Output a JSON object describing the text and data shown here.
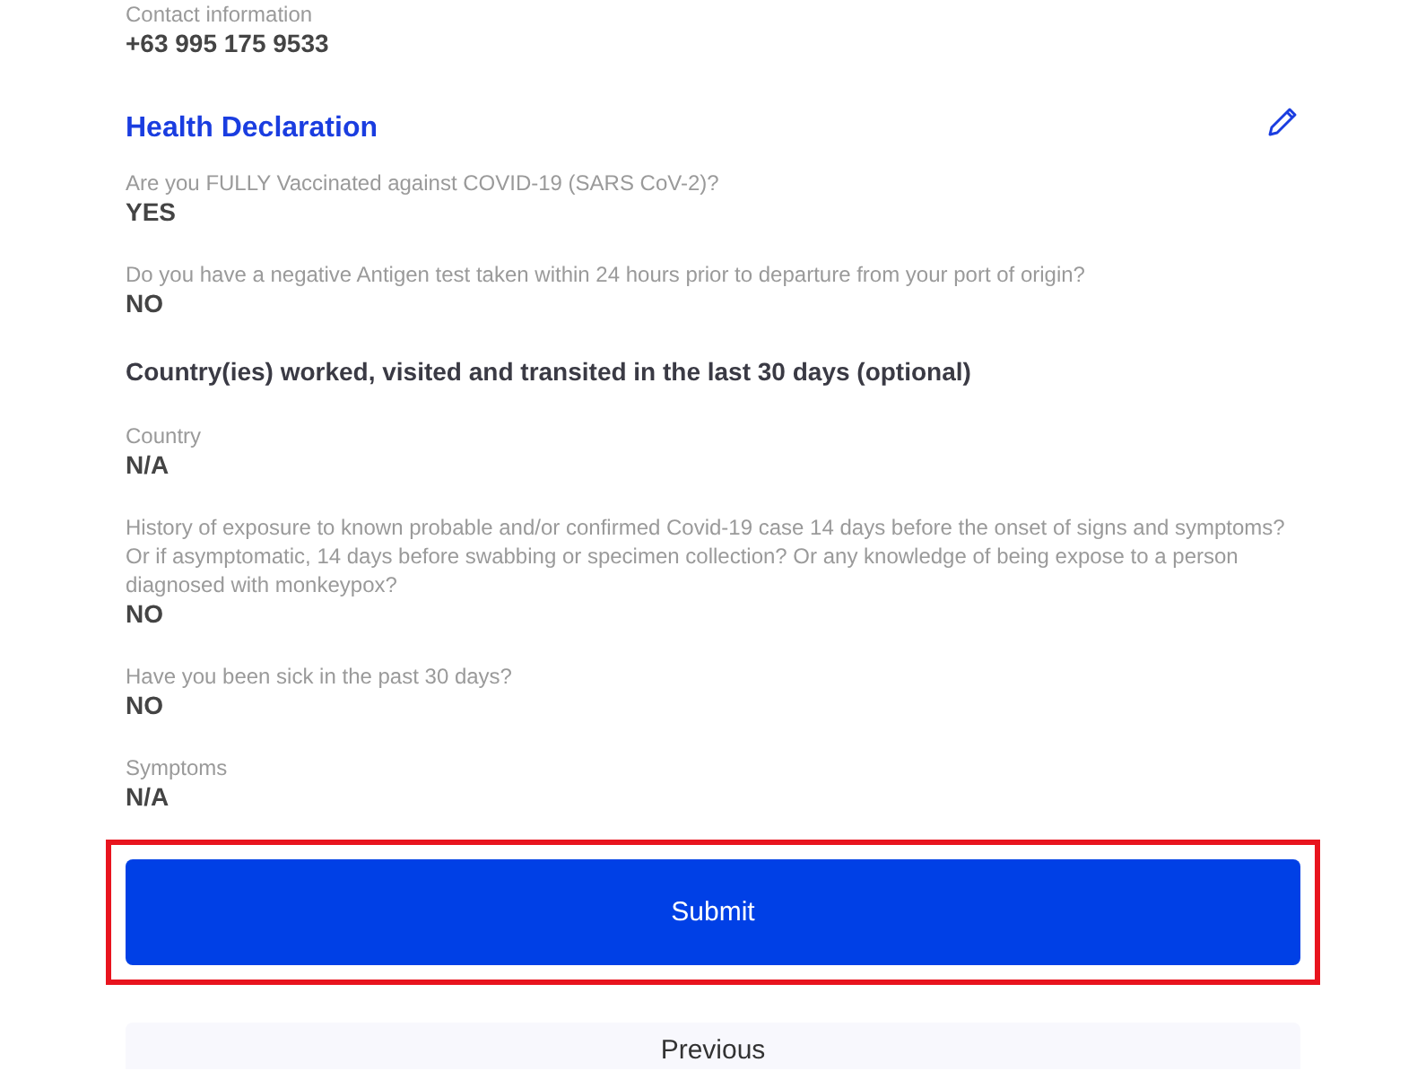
{
  "contact": {
    "label": "Contact information",
    "value": "+63 995 175 9533"
  },
  "health_declaration": {
    "title": "Health Declaration",
    "items": [
      {
        "kind": "field",
        "label": "Are you FULLY Vaccinated against COVID-19 (SARS CoV-2)?",
        "value": "YES"
      },
      {
        "kind": "field",
        "label": "Do you have a negative Antigen test taken within 24 hours prior to departure from your port of origin?",
        "value": "NO"
      },
      {
        "kind": "heading",
        "text": "Country(ies) worked, visited and transited in the last 30 days (optional)"
      },
      {
        "kind": "field",
        "label": "Country",
        "value": "N/A"
      },
      {
        "kind": "field",
        "label": "History of exposure to known probable and/or confirmed Covid-19 case 14 days before the onset of signs and symptoms? Or if asymptomatic, 14 days before swabbing or specimen collection? Or any knowledge of being expose to a person diagnosed with monkeypox?",
        "value": "NO"
      },
      {
        "kind": "field",
        "label": "Have you been sick in the past 30 days?",
        "value": "NO"
      },
      {
        "kind": "field",
        "label": "Symptoms",
        "value": "N/A"
      }
    ]
  },
  "buttons": [
    {
      "label": "Submit",
      "kind": "primary",
      "highlighted": true
    },
    {
      "label": "Previous",
      "kind": "secondary",
      "highlighted": false
    }
  ]
}
